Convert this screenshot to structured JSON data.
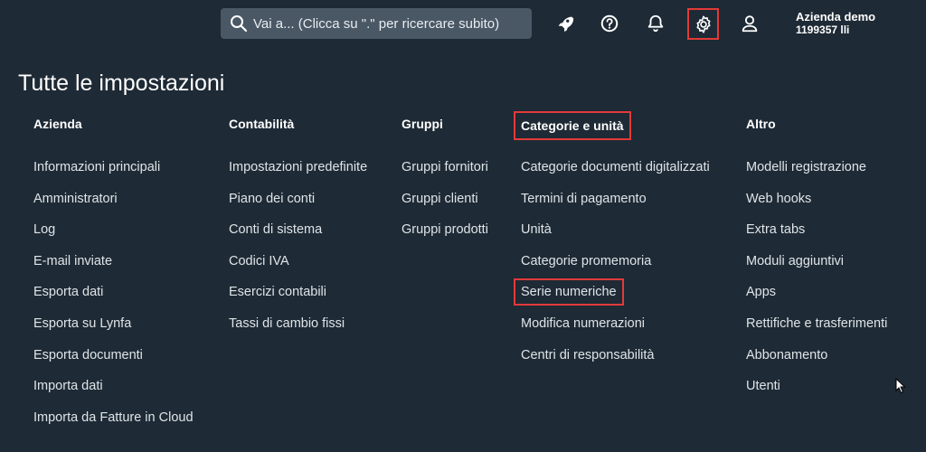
{
  "topbar": {
    "search_placeholder": "Vai a... (Clicca su \".\" per ricercare subito)",
    "icons": [
      "rocket-icon",
      "help-icon",
      "bell-icon",
      "gear-icon",
      "user-icon"
    ],
    "user_name": "Azienda demo",
    "user_id": "1199357 lli"
  },
  "page_title": "Tutte le impostazioni",
  "highlight_color": "#e23a3a",
  "columns": [
    {
      "heading": "Azienda",
      "items": [
        "Informazioni principali",
        "Amministratori",
        "Log",
        "E-mail inviate",
        "Esporta dati",
        "Esporta su Lynfa",
        "Esporta documenti",
        "Importa dati",
        "Importa da Fatture in Cloud"
      ]
    },
    {
      "heading": "Contabilità",
      "items": [
        "Impostazioni predefinite",
        "Piano dei conti",
        "Conti di sistema",
        "Codici IVA",
        "Esercizi contabili",
        "Tassi di cambio fissi"
      ]
    },
    {
      "heading": "Gruppi",
      "items": [
        "Gruppi fornitori",
        "Gruppi clienti",
        "Gruppi prodotti"
      ]
    },
    {
      "heading": "Categorie e unità",
      "items": [
        "Categorie documenti digitalizzati",
        "Termini di pagamento",
        "Unità",
        "Categorie promemoria",
        "Serie numeriche",
        "Modifica numerazioni",
        "Centri di responsabilità"
      ]
    },
    {
      "heading": "Altro",
      "items": [
        "Modelli registrazione",
        "Web hooks",
        "Extra tabs",
        "Moduli aggiuntivi",
        "Apps",
        "Rettifiche e trasferimenti",
        "Abbonamento",
        "Utenti"
      ]
    }
  ]
}
